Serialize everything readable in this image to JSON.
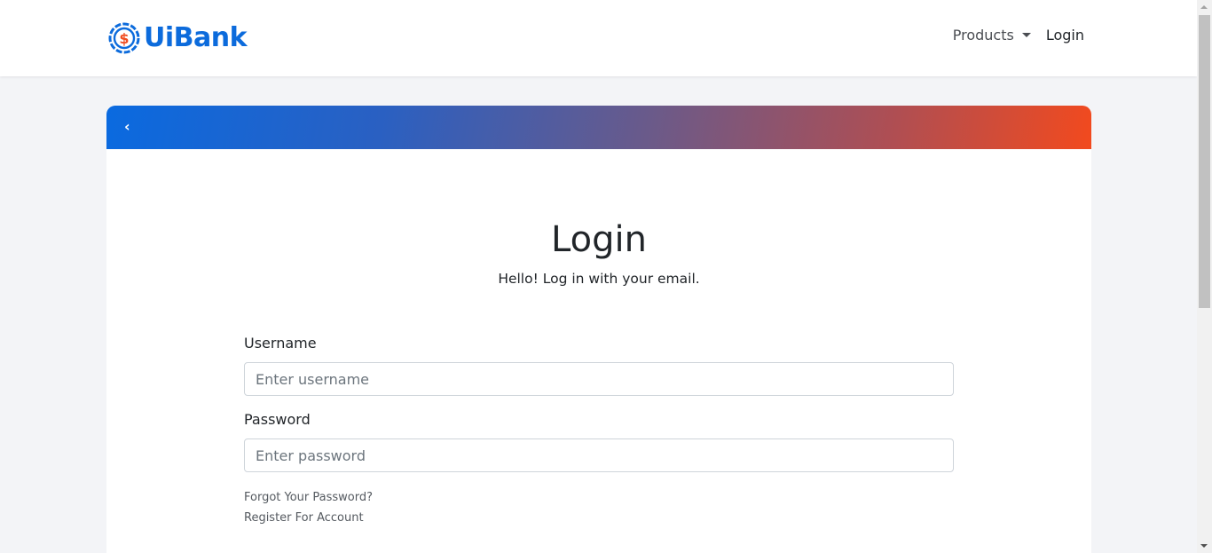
{
  "brand": {
    "name": "UiBank",
    "logo_symbol": "$",
    "primary_color": "#0c6bdc",
    "accent_color": "#f04e23"
  },
  "nav": {
    "products_label": "Products",
    "login_label": "Login"
  },
  "card": {
    "back_icon": "chevron-left-icon",
    "back_symbol": "‹",
    "header_gradient": [
      "#0a6ae0",
      "#f24a1e"
    ]
  },
  "form": {
    "title": "Login",
    "subtitle": "Hello! Log in with your email.",
    "username": {
      "label": "Username",
      "placeholder": "Enter username",
      "value": ""
    },
    "password": {
      "label": "Password",
      "placeholder": "Enter password",
      "value": ""
    },
    "forgot_password_label": "Forgot Your Password?",
    "register_label": "Register For Account"
  }
}
